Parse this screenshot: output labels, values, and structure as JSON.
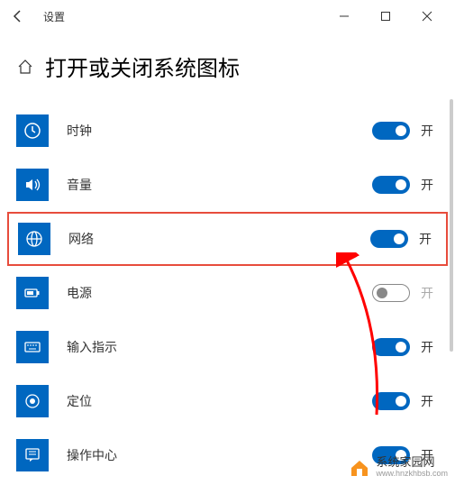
{
  "titlebar": {
    "app_title": "设置"
  },
  "header": {
    "page_title": "打开或关闭系统图标"
  },
  "settings": [
    {
      "key": "clock",
      "label": "时钟",
      "state": "开",
      "on": true,
      "disabled": false,
      "highlighted": false
    },
    {
      "key": "volume",
      "label": "音量",
      "state": "开",
      "on": true,
      "disabled": false,
      "highlighted": false
    },
    {
      "key": "network",
      "label": "网络",
      "state": "开",
      "on": true,
      "disabled": false,
      "highlighted": true
    },
    {
      "key": "power",
      "label": "电源",
      "state": "开",
      "on": false,
      "disabled": true,
      "highlighted": false
    },
    {
      "key": "input",
      "label": "输入指示",
      "state": "开",
      "on": true,
      "disabled": false,
      "highlighted": false
    },
    {
      "key": "location",
      "label": "定位",
      "state": "开",
      "on": true,
      "disabled": false,
      "highlighted": false
    },
    {
      "key": "action_center",
      "label": "操作中心",
      "state": "开",
      "on": true,
      "disabled": false,
      "highlighted": false
    }
  ],
  "watermark": {
    "name": "系统家园网",
    "url": "www.hnzkhbsb.com"
  },
  "colors": {
    "accent": "#0067c0",
    "highlight_border": "#e74c3c",
    "arrow": "#ff0000"
  }
}
